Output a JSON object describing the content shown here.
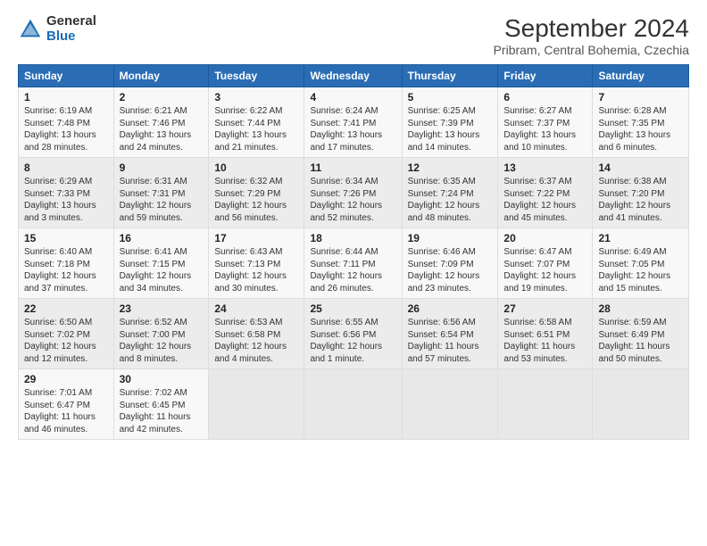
{
  "header": {
    "logo_general": "General",
    "logo_blue": "Blue",
    "month_year": "September 2024",
    "location": "Pribram, Central Bohemia, Czechia"
  },
  "days_of_week": [
    "Sunday",
    "Monday",
    "Tuesday",
    "Wednesday",
    "Thursday",
    "Friday",
    "Saturday"
  ],
  "weeks": [
    [
      {
        "day": "1",
        "info": "Sunrise: 6:19 AM\nSunset: 7:48 PM\nDaylight: 13 hours\nand 28 minutes."
      },
      {
        "day": "2",
        "info": "Sunrise: 6:21 AM\nSunset: 7:46 PM\nDaylight: 13 hours\nand 24 minutes."
      },
      {
        "day": "3",
        "info": "Sunrise: 6:22 AM\nSunset: 7:44 PM\nDaylight: 13 hours\nand 21 minutes."
      },
      {
        "day": "4",
        "info": "Sunrise: 6:24 AM\nSunset: 7:41 PM\nDaylight: 13 hours\nand 17 minutes."
      },
      {
        "day": "5",
        "info": "Sunrise: 6:25 AM\nSunset: 7:39 PM\nDaylight: 13 hours\nand 14 minutes."
      },
      {
        "day": "6",
        "info": "Sunrise: 6:27 AM\nSunset: 7:37 PM\nDaylight: 13 hours\nand 10 minutes."
      },
      {
        "day": "7",
        "info": "Sunrise: 6:28 AM\nSunset: 7:35 PM\nDaylight: 13 hours\nand 6 minutes."
      }
    ],
    [
      {
        "day": "8",
        "info": "Sunrise: 6:29 AM\nSunset: 7:33 PM\nDaylight: 13 hours\nand 3 minutes."
      },
      {
        "day": "9",
        "info": "Sunrise: 6:31 AM\nSunset: 7:31 PM\nDaylight: 12 hours\nand 59 minutes."
      },
      {
        "day": "10",
        "info": "Sunrise: 6:32 AM\nSunset: 7:29 PM\nDaylight: 12 hours\nand 56 minutes."
      },
      {
        "day": "11",
        "info": "Sunrise: 6:34 AM\nSunset: 7:26 PM\nDaylight: 12 hours\nand 52 minutes."
      },
      {
        "day": "12",
        "info": "Sunrise: 6:35 AM\nSunset: 7:24 PM\nDaylight: 12 hours\nand 48 minutes."
      },
      {
        "day": "13",
        "info": "Sunrise: 6:37 AM\nSunset: 7:22 PM\nDaylight: 12 hours\nand 45 minutes."
      },
      {
        "day": "14",
        "info": "Sunrise: 6:38 AM\nSunset: 7:20 PM\nDaylight: 12 hours\nand 41 minutes."
      }
    ],
    [
      {
        "day": "15",
        "info": "Sunrise: 6:40 AM\nSunset: 7:18 PM\nDaylight: 12 hours\nand 37 minutes."
      },
      {
        "day": "16",
        "info": "Sunrise: 6:41 AM\nSunset: 7:15 PM\nDaylight: 12 hours\nand 34 minutes."
      },
      {
        "day": "17",
        "info": "Sunrise: 6:43 AM\nSunset: 7:13 PM\nDaylight: 12 hours\nand 30 minutes."
      },
      {
        "day": "18",
        "info": "Sunrise: 6:44 AM\nSunset: 7:11 PM\nDaylight: 12 hours\nand 26 minutes."
      },
      {
        "day": "19",
        "info": "Sunrise: 6:46 AM\nSunset: 7:09 PM\nDaylight: 12 hours\nand 23 minutes."
      },
      {
        "day": "20",
        "info": "Sunrise: 6:47 AM\nSunset: 7:07 PM\nDaylight: 12 hours\nand 19 minutes."
      },
      {
        "day": "21",
        "info": "Sunrise: 6:49 AM\nSunset: 7:05 PM\nDaylight: 12 hours\nand 15 minutes."
      }
    ],
    [
      {
        "day": "22",
        "info": "Sunrise: 6:50 AM\nSunset: 7:02 PM\nDaylight: 12 hours\nand 12 minutes."
      },
      {
        "day": "23",
        "info": "Sunrise: 6:52 AM\nSunset: 7:00 PM\nDaylight: 12 hours\nand 8 minutes."
      },
      {
        "day": "24",
        "info": "Sunrise: 6:53 AM\nSunset: 6:58 PM\nDaylight: 12 hours\nand 4 minutes."
      },
      {
        "day": "25",
        "info": "Sunrise: 6:55 AM\nSunset: 6:56 PM\nDaylight: 12 hours\nand 1 minute."
      },
      {
        "day": "26",
        "info": "Sunrise: 6:56 AM\nSunset: 6:54 PM\nDaylight: 11 hours\nand 57 minutes."
      },
      {
        "day": "27",
        "info": "Sunrise: 6:58 AM\nSunset: 6:51 PM\nDaylight: 11 hours\nand 53 minutes."
      },
      {
        "day": "28",
        "info": "Sunrise: 6:59 AM\nSunset: 6:49 PM\nDaylight: 11 hours\nand 50 minutes."
      }
    ],
    [
      {
        "day": "29",
        "info": "Sunrise: 7:01 AM\nSunset: 6:47 PM\nDaylight: 11 hours\nand 46 minutes."
      },
      {
        "day": "30",
        "info": "Sunrise: 7:02 AM\nSunset: 6:45 PM\nDaylight: 11 hours\nand 42 minutes."
      },
      {
        "day": "",
        "info": ""
      },
      {
        "day": "",
        "info": ""
      },
      {
        "day": "",
        "info": ""
      },
      {
        "day": "",
        "info": ""
      },
      {
        "day": "",
        "info": ""
      }
    ]
  ]
}
